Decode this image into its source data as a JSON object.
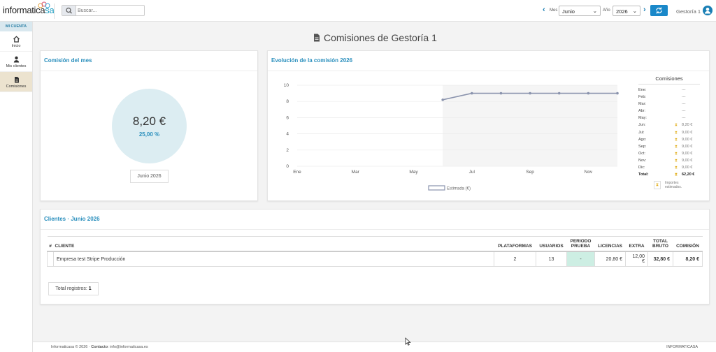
{
  "header": {
    "logo_main": "informatica",
    "logo_accent": "sa",
    "search_placeholder": "Buscar...",
    "mes_label": "Mes",
    "mes_value": "Junio",
    "anio_label": "Año",
    "anio_value": "2026",
    "user_name": "Gestoría 1"
  },
  "sidebar": {
    "section": "MI CUENTA",
    "items": [
      {
        "label": "Inicio",
        "icon": "home-icon"
      },
      {
        "label": "Mis clientes",
        "icon": "user-icon"
      },
      {
        "label": "Comisiones",
        "icon": "file-icon",
        "active": true
      }
    ]
  },
  "page": {
    "title": "Comisiones de Gestoría 1"
  },
  "monthly": {
    "title": "Comisión del mes",
    "amount": "8,20 €",
    "percent": "25,00 %",
    "period": "Junio 2026"
  },
  "evolution": {
    "title": "Evolución de la comisión 2026",
    "legend_title": "Comisiones",
    "rows": [
      {
        "month": "Ene:",
        "value": "---",
        "estimated": false
      },
      {
        "month": "Feb:",
        "value": "---",
        "estimated": false
      },
      {
        "month": "Mar:",
        "value": "---",
        "estimated": false
      },
      {
        "month": "Abr:",
        "value": "---",
        "estimated": false
      },
      {
        "month": "May:",
        "value": "---",
        "estimated": false
      },
      {
        "month": "Jun:",
        "value": "8,20 €",
        "estimated": true
      },
      {
        "month": "Jul:",
        "value": "9,00 €",
        "estimated": true
      },
      {
        "month": "Ago:",
        "value": "9,00 €",
        "estimated": true
      },
      {
        "month": "Sep:",
        "value": "9,00 €",
        "estimated": true
      },
      {
        "month": "Oct:",
        "value": "9,00 €",
        "estimated": true
      },
      {
        "month": "Nov:",
        "value": "9,00 €",
        "estimated": true
      },
      {
        "month": "Dic:",
        "value": "9,00 €",
        "estimated": true
      }
    ],
    "total_label": "Total:",
    "total_value": "62,20 €",
    "note_line1": "Importes",
    "note_line2": "estimados."
  },
  "chart_data": {
    "type": "line",
    "x": [
      "Ene",
      "Feb",
      "Mar",
      "Abr",
      "May",
      "Jun",
      "Jul",
      "Ago",
      "Sep",
      "Oct",
      "Nov",
      "Dic"
    ],
    "x_tick_labels": [
      "Ene",
      "Mar",
      "May",
      "Jul",
      "Sep",
      "Nov"
    ],
    "series": [
      {
        "name": "Estimada (€)",
        "values": [
          null,
          null,
          null,
          null,
          null,
          8.2,
          9.0,
          9.0,
          9.0,
          9.0,
          9.0,
          9.0
        ]
      }
    ],
    "ylim": [
      0,
      10
    ],
    "yticks": [
      0,
      2,
      4,
      6,
      8,
      10
    ],
    "grid": true,
    "legend_position": "bottom",
    "colors": {
      "line": "#8a93ad",
      "area": "#f5f5f5"
    }
  },
  "clients": {
    "title": "Clientes · Junio 2026",
    "columns": {
      "num": "#",
      "cliente": "CLIENTE",
      "plataformas": "PLATAFORMAS",
      "usuarios": "USUARIOS",
      "periodo1": "PERIODO",
      "periodo2": "PRUEBA",
      "licencias": "LICENCIAS",
      "extra": "EXTRA",
      "total1": "TOTAL",
      "total2": "BRUTO",
      "comision": "COMISIÓN"
    },
    "rows": [
      {
        "num": "",
        "cliente": "Empresa test Stripe Producción",
        "plataformas": "2",
        "usuarios": "13",
        "prueba": "-",
        "licencias": "20,80 €",
        "extra": "12,00 €",
        "total": "32,80 €",
        "comision": "8,20 €"
      }
    ],
    "total_label": "Total registros:",
    "total_count": "1"
  },
  "footer": {
    "left_a": "Informaticasa © 2026 · ",
    "left_b": "Contacto",
    "left_c": ": info@informaticasa.es",
    "right": "INFORMATICASA"
  }
}
